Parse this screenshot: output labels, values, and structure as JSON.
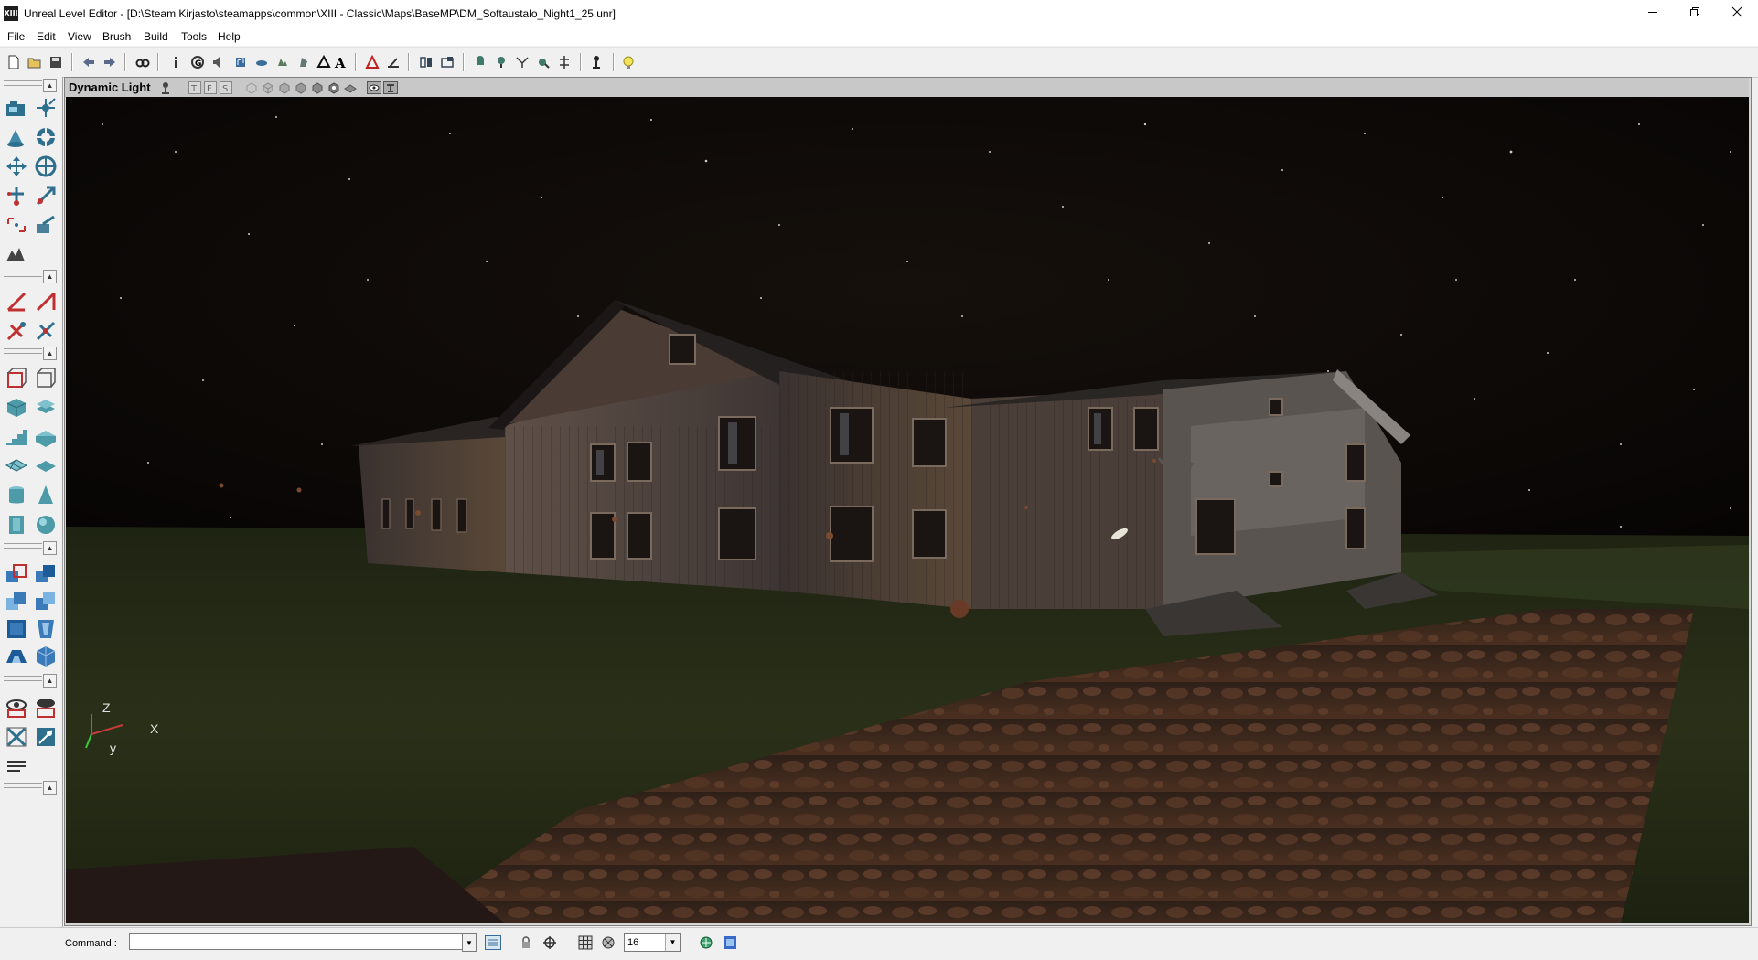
{
  "window": {
    "app_icon": "XIII",
    "title": "Unreal Level Editor - [D:\\Steam Kirjasto\\steamapps\\common\\XIII - Classic\\Maps\\BaseMP\\DM_Softaustalo_Night1_25.unr]",
    "controls": [
      "minimize-icon",
      "restore-icon",
      "close-icon"
    ]
  },
  "menu": {
    "items": [
      "File",
      "Edit",
      "View",
      "Brush",
      "Build",
      "Tools",
      "Help"
    ]
  },
  "toolbar": {
    "icons": [
      "new-map-icon",
      "open-map-icon",
      "save-map-icon",
      "undo-icon",
      "redo-icon",
      "find-actors-icon",
      "actor-properties-icon",
      "group-browser-icon",
      "sound-browser-icon",
      "music-browser-icon",
      "texture-browser-icon",
      "mesh-browser-icon",
      "animation-browser-icon",
      "static-mesh-browser-icon",
      "font-browser-icon",
      "terrain-editor-icon",
      "2d-shape-editor-icon",
      "build-geometry-icon",
      "build-lighting-icon",
      "build-paths-icon",
      "build-all-icon",
      "build-options-icon",
      "play-level-icon",
      "light-bulb-icon"
    ]
  },
  "viewport": {
    "mode_label": "Dynamic Light",
    "header_icons": [
      "viewport-options-icon",
      "top-view-icon",
      "front-view-icon",
      "side-view-icon",
      "wireframe-icon",
      "zone-icon",
      "texture-usage-icon",
      "bsp-cuts-icon",
      "textured-icon",
      "dynamic-light-icon",
      "real-time-preview-icon",
      "lock-viewport-icon"
    ],
    "axis": {
      "z": "Z",
      "x": "X",
      "y": "y"
    },
    "scene_description_colors": {
      "sky": "#0b0806",
      "grass": "#262a18",
      "house": "#4a3a2e",
      "path": "#3a2418"
    }
  },
  "left_panel": {
    "groups": [
      [
        "camera-move-icon",
        "vertex-edit-icon",
        "actor-rotate-icon",
        "brush-clip-icon",
        "actor-scale-icon",
        "texture-pan-icon",
        "texture-rotate-icon",
        "texture-scale-icon",
        "brush-resize-icon",
        "face-drag-icon",
        "terrain-icon"
      ],
      [
        "polygon-clip-icon",
        "brush-clip-split-icon",
        "clip-both-icon",
        "clip-delete-icon"
      ],
      [
        "cube-builder-icon",
        "sheet-builder-icon",
        "cylinder-builder-icon",
        "cone-builder-icon",
        "stair-builder-icon",
        "spiral-stair-icon",
        "curved-stair-icon",
        "terrain-builder-icon",
        "sheet-icon",
        "volume-icon",
        "tetrahedron-builder-icon",
        "sphere-builder-icon"
      ],
      [
        "csg-add-icon",
        "csg-subtract-icon",
        "csg-intersect-icon",
        "csg-deintersect-icon",
        "add-mover-icon",
        "add-special-icon",
        "add-volume-icon",
        "add-static-mesh-icon"
      ],
      [
        "show-selected-icon",
        "hide-selected-icon",
        "select-inside-icon",
        "invert-selection-icon",
        "align-icon"
      ]
    ]
  },
  "statusbar": {
    "command_label": "Command :",
    "command_value": "",
    "grid_size": "16",
    "icons": [
      "log-window-icon",
      "drag-grid-icon",
      "rotation-grid-icon",
      "grid-icon",
      "grid-snap-icon",
      "maximize-viewport-icon",
      "full-screen-icon"
    ]
  }
}
